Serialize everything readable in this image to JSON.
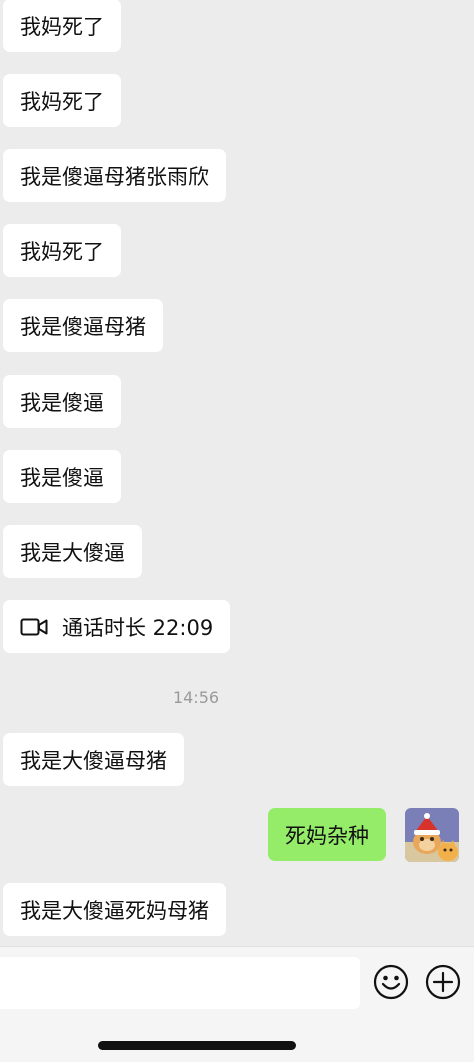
{
  "messages": [
    {
      "text": "我妈死了"
    },
    {
      "text": "我妈死了"
    },
    {
      "text": "我是傻逼母猪张雨欣"
    },
    {
      "text": "我妈死了"
    },
    {
      "text": "我是傻逼母猪"
    },
    {
      "text": "我是傻逼"
    },
    {
      "text": "我是傻逼"
    },
    {
      "text": "我是大傻逼"
    },
    {
      "call_text": "通话时长 22:09",
      "icon": "video-call-icon"
    },
    {
      "text": "我是大傻逼母猪"
    },
    {
      "text": "死妈杂种"
    },
    {
      "text": "我是大傻逼死妈母猪"
    }
  ],
  "timestamp": "14:56",
  "input": {
    "value": "",
    "emoji_icon": "emoji-icon",
    "more_icon": "plus-circle-icon"
  },
  "colors": {
    "background": "#ececec",
    "incoming_bubble": "#ffffff",
    "outgoing_bubble": "#95ec69",
    "text": "#111111",
    "timestamp": "#9a9a9a"
  }
}
